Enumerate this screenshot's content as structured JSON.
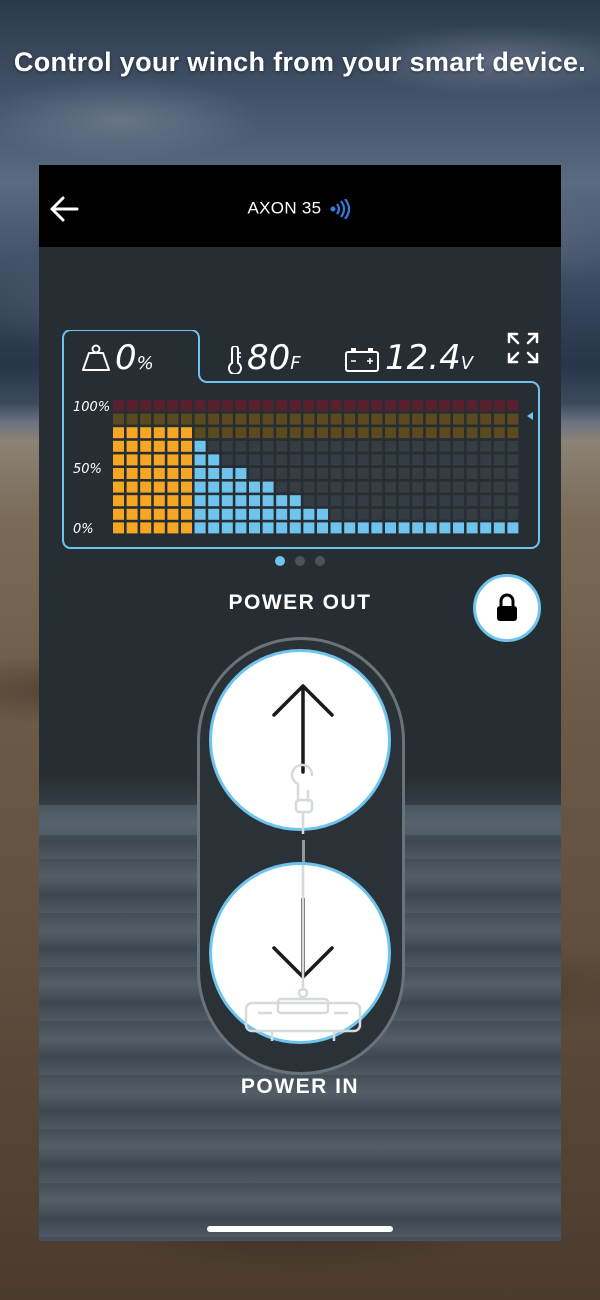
{
  "headline": "Control your winch from your smart device.",
  "topbar": {
    "title": "AXON 35",
    "back_icon": "back-arrow-icon",
    "signal_icon": "bluetooth-signal-icon"
  },
  "gauge": {
    "load": {
      "value": "0",
      "unit": "%",
      "icon": "weight-icon"
    },
    "temperature": {
      "value": "80",
      "unit": "F",
      "icon": "thermometer-icon"
    },
    "voltage": {
      "value": "12.4",
      "unit": "V",
      "icon": "battery-icon"
    },
    "y_labels": {
      "top": "100%",
      "mid": "50%",
      "bottom": "0%"
    },
    "colors": {
      "orange": "#f5a623",
      "blue": "#6fc4ee",
      "dark": "#343d44",
      "maroon": "#5a1f2e",
      "olive": "#5a4a1e",
      "accent": "#6fc4ee"
    }
  },
  "pagination": {
    "count": 3,
    "active": 0
  },
  "controls": {
    "power_out_label": "POWER OUT",
    "power_in_label": "POWER IN",
    "lock_icon": "lock-icon",
    "up_icon": "arrow-up-icon",
    "down_icon": "arrow-down-icon"
  }
}
